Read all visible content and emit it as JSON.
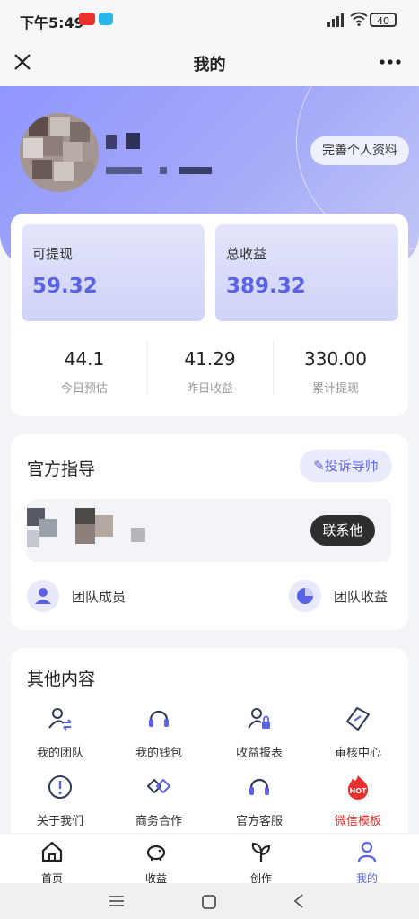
{
  "status": {
    "time": "下午5:49",
    "battery": "40"
  },
  "titlebar": {
    "title": "我的"
  },
  "header": {
    "profile_button": "完善个人资料"
  },
  "earnings": {
    "withdrawable_label": "可提现",
    "withdrawable_value": "59.32",
    "total_label": "总收益",
    "total_value": "389.32",
    "stats": [
      {
        "value": "44.1",
        "label": "今日预估"
      },
      {
        "value": "41.29",
        "label": "昨日收益"
      },
      {
        "value": "330.00",
        "label": "累计提现"
      }
    ]
  },
  "guidance": {
    "title": "官方指导",
    "complain_button": "投诉导师",
    "contact_button": "联系他",
    "team_members": "团队成员",
    "team_earnings": "团队收益"
  },
  "other": {
    "title": "其他内容",
    "items": [
      {
        "label": "我的团队",
        "icon": "team-icon"
      },
      {
        "label": "我的钱包",
        "icon": "wallet-icon"
      },
      {
        "label": "收益报表",
        "icon": "report-icon"
      },
      {
        "label": "审核中心",
        "icon": "review-icon"
      },
      {
        "label": "关于我们",
        "icon": "info-icon"
      },
      {
        "label": "商务合作",
        "icon": "handshake-icon"
      },
      {
        "label": "官方客服",
        "icon": "headset-icon"
      },
      {
        "label": "微信模板",
        "icon": "hot-icon",
        "badge": "HOT"
      }
    ]
  },
  "tabs": [
    {
      "label": "首页",
      "icon": "home-icon"
    },
    {
      "label": "收益",
      "icon": "piggy-bank-icon"
    },
    {
      "label": "创作",
      "icon": "leaf-icon"
    },
    {
      "label": "我的",
      "icon": "person-icon"
    }
  ],
  "colors": {
    "accent": "#5a62e6",
    "hot": "#e8322e"
  }
}
